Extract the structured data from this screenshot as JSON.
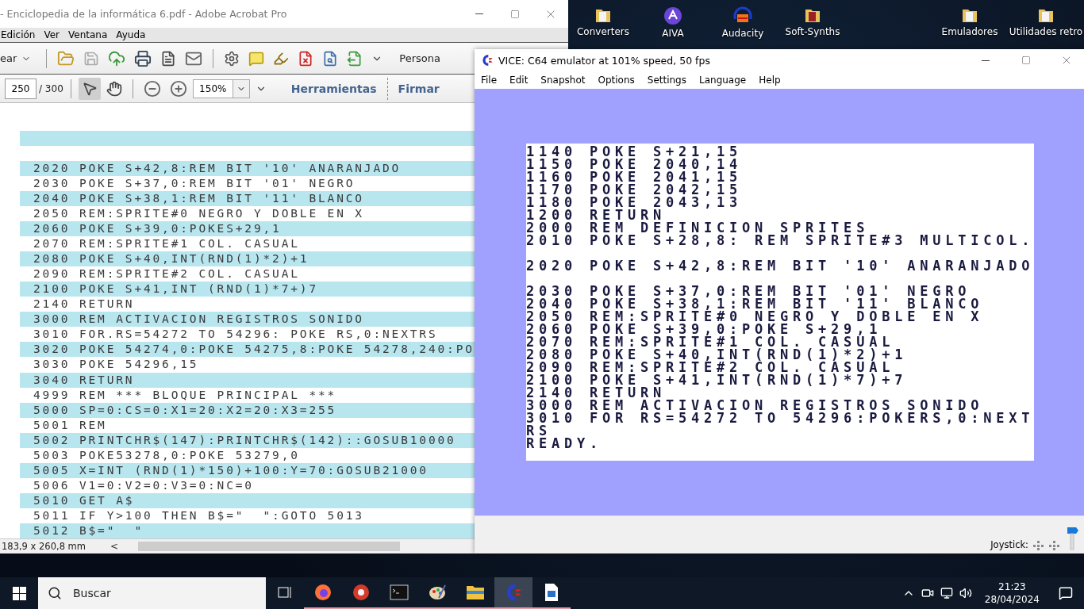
{
  "desktop_icons": [
    {
      "label": "Converters",
      "kind": "folder"
    },
    {
      "label": "AIVA",
      "kind": "aiva"
    },
    {
      "label": "Audacity",
      "kind": "audacity"
    },
    {
      "label": "Soft-Synths",
      "kind": "folder-red"
    },
    {
      "label": "Emuladores",
      "kind": "folder"
    },
    {
      "label": "Utilidades retro",
      "kind": "folder"
    }
  ],
  "acrobat": {
    "title": "- Enciclopedia de la informática 6.pdf - Adobe Acrobat Pro",
    "menu": [
      "Edición",
      "Ver",
      "Ventana",
      "Ayuda"
    ],
    "create_label": "ear",
    "right_label": "Persona",
    "page_number": "250",
    "page_total": "/ 300",
    "zoom": "150%",
    "tools": "Herramientas",
    "sign": "Firmar",
    "lines": [
      {
        "text": "2020 POKE S+42,8:REM BIT '10' ANARANJADO",
        "striped": true
      },
      {
        "text": "2030 POKE S+37,0:REM BIT '01' NEGRO",
        "striped": false
      },
      {
        "text": "2040 POKE S+38,1:REM BIT '11' BLANCO",
        "striped": true
      },
      {
        "text": "2050 REM:SPRITE#0 NEGRO Y DOBLE EN X",
        "striped": false
      },
      {
        "text": "2060 POKE S+39,0:POKES+29,1",
        "striped": true
      },
      {
        "text": "2070 REM:SPRITE#1 COL. CASUAL",
        "striped": false
      },
      {
        "text": "2080 POKE S+40,INT(RND(1)*2)+1",
        "striped": true
      },
      {
        "text": "2090 REM:SPRITE#2 COL. CASUAL",
        "striped": false
      },
      {
        "text": "2100 POKE S+41,INT (RND(1)*7+)7",
        "striped": true
      },
      {
        "text": "2140 RETURN",
        "striped": false
      },
      {
        "text": "3000 REM ACTIVACION REGISTROS SONIDO",
        "striped": true
      },
      {
        "text": "3010 FOR.RS=54272 TO 54296: POKE RS,0:NEXTRS",
        "striped": false
      },
      {
        "text": "3020 POKE 54274,0:POKE 54275,8:POKE 54278,240:PO",
        "striped": true
      },
      {
        "text": "3030 POKE 54296,15",
        "striped": false
      },
      {
        "text": "3040 RETURN",
        "striped": true
      },
      {
        "text": "4999 REM *** BLOQUE PRINCIPAL ***",
        "striped": false
      },
      {
        "text": "5000 SP=0:CS=0:X1=20:X2=20:X3=255",
        "striped": true
      },
      {
        "text": "5001 REM",
        "striped": false
      },
      {
        "text": "5002 PRINTCHR$(147):PRINTCHR$(142)::GOSUB10000",
        "striped": true
      },
      {
        "text": "5003 POKE53278,0:POKE 53279,0",
        "striped": false
      },
      {
        "text": "5005 X=INT (RND(1)*150)+100:Y=70:GOSUB21000",
        "striped": true
      },
      {
        "text": "5006 V1=0:V2=0:V3=0:NC=0",
        "striped": false
      },
      {
        "text": "5010 GET A$",
        "striped": true
      },
      {
        "text": "5011 IF Y>100 THEN B$=\"  \":GOTO 5013",
        "striped": false
      },
      {
        "text": "5012 B$=\"  \"",
        "striped": true
      }
    ],
    "status": "183,9 x 260,8 mm",
    "scroll_left": "<"
  },
  "vice": {
    "title": "VICE: C64 emulator at 101% speed, 50 fps",
    "menu": [
      "File",
      "Edit",
      "Snapshot",
      "Options",
      "Settings",
      "Language",
      "Help"
    ],
    "screen_lines": [
      {
        "text": "1140 POKE S+21,15",
        "gap_after": false
      },
      {
        "text": "1150 POKE 2040,14",
        "gap_after": false
      },
      {
        "text": "1160 POKE 2041,15",
        "gap_after": false
      },
      {
        "text": "1170 POKE 2042,15",
        "gap_after": false
      },
      {
        "text": "1180 POKE 2043,13",
        "gap_after": false
      },
      {
        "text": "1200 RETURN",
        "gap_after": false
      },
      {
        "text": "2000 REM DEFINICION SPRITES",
        "gap_after": false
      },
      {
        "text": "2010 POKE S+28,8: REM SPRITE#3 MULTICOL.",
        "gap_after": true
      },
      {
        "text": "2020 POKE S+42,8:REM BIT '10' ANARANJADO",
        "gap_after": true
      },
      {
        "text": "2030 POKE S+37,0:REM BIT '01' NEGRO",
        "gap_after": false
      },
      {
        "text": "2040 POKE S+38,1:REM BIT '11' BLANCO",
        "gap_after": false
      },
      {
        "text": "2050 REM:SPRITE#0 NEGRO Y DOBLE EN X",
        "gap_after": false
      },
      {
        "text": "2060 POKE S+39,0:POKE S+29,1",
        "gap_after": false
      },
      {
        "text": "2070 REM:SPRITE#1 COL. CASUAL",
        "gap_after": false
      },
      {
        "text": "2080 POKE S+40,INT(RND(1)*2)+1",
        "gap_after": false
      },
      {
        "text": "2090 REM:SPRITE#2 COL. CASUAL",
        "gap_after": false
      },
      {
        "text": "2100 POKE S+41,INT(RND(1)*7)+7",
        "gap_after": false
      },
      {
        "text": "2140 RETURN",
        "gap_after": false
      },
      {
        "text": "3000 REM ACTIVACION REGISTROS SONIDO",
        "gap_after": false
      },
      {
        "text": "3010 FOR RS=54272 TO 54296:POKERS,0:NEXT",
        "gap_after": false
      },
      {
        "text": "RS",
        "gap_after": false
      },
      {
        "text": "READY.",
        "gap_after": false
      }
    ],
    "status_label": "Joystick:"
  },
  "taskbar": {
    "search_placeholder": "Buscar",
    "apps": [
      {
        "kind": "browser",
        "selected": false
      },
      {
        "kind": "disc",
        "selected": false
      },
      {
        "kind": "terminal",
        "selected": false
      },
      {
        "kind": "palette",
        "selected": false
      },
      {
        "kind": "folder",
        "selected": false
      },
      {
        "kind": "commodore",
        "selected": true
      },
      {
        "kind": "document",
        "selected": false
      }
    ],
    "time": "21:23",
    "date": "28/04/2024"
  }
}
